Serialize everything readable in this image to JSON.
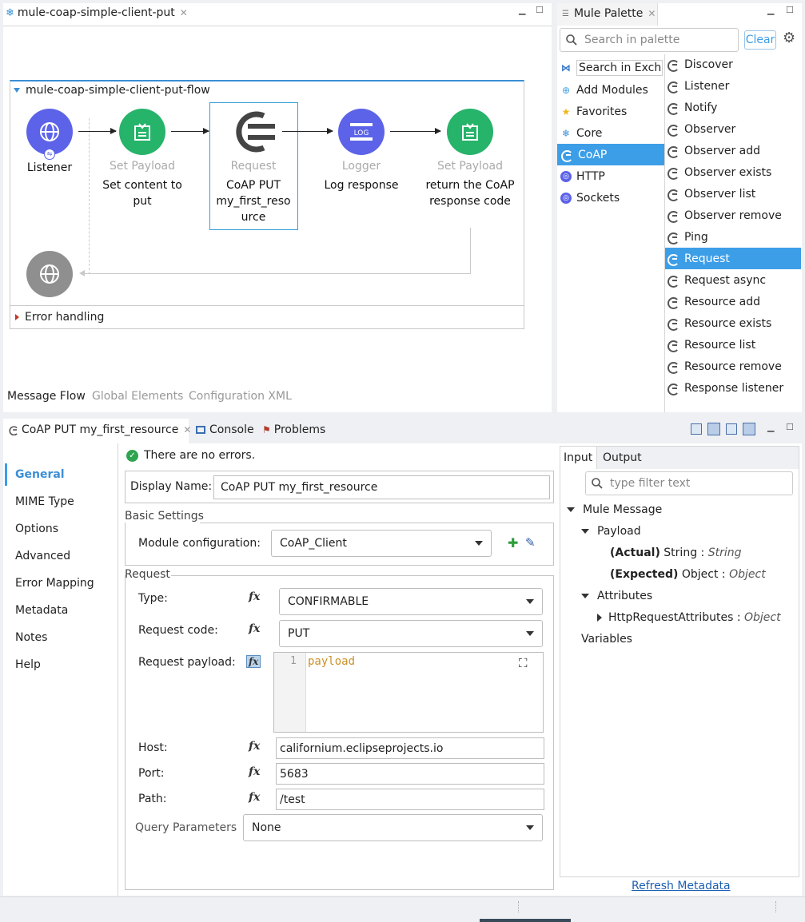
{
  "editor": {
    "tab_title": "mule-coap-simple-client-put",
    "flow_name": "mule-coap-simple-client-put-flow",
    "nodes": [
      {
        "type": "",
        "label": "Listener"
      },
      {
        "type": "Set Payload",
        "label": "Set content to put"
      },
      {
        "type": "Request",
        "label": "CoAP PUT my_first_reso urce"
      },
      {
        "type": "Logger",
        "label": "Log response"
      },
      {
        "type": "Set Payload",
        "label": "return the CoAP response code"
      }
    ],
    "logger_icon_text": "LOG",
    "error_handling": "Error handling",
    "bottom_tabs": [
      "Message Flow",
      "Global Elements",
      "Configuration XML"
    ]
  },
  "palette": {
    "title": "Mule Palette",
    "search_placeholder": "Search in palette",
    "clear_label": "Clear",
    "left_items": [
      {
        "label": "Search in Excha",
        "icon": "exchange-icon"
      },
      {
        "label": "Add Modules",
        "icon": "add-circle-icon"
      },
      {
        "label": "Favorites",
        "icon": "star-icon"
      },
      {
        "label": "Core",
        "icon": "mule-icon"
      },
      {
        "label": "CoAP",
        "icon": "coap-icon"
      },
      {
        "label": "HTTP",
        "icon": "globe-icon"
      },
      {
        "label": "Sockets",
        "icon": "globe-icon"
      }
    ],
    "right_items": [
      "Discover",
      "Listener",
      "Notify",
      "Observer",
      "Observer add",
      "Observer exists",
      "Observer list",
      "Observer remove",
      "Ping",
      "Request",
      "Request async",
      "Resource add",
      "Resource exists",
      "Resource list",
      "Resource remove",
      "Response listener"
    ],
    "selected_left": "CoAP",
    "selected_right": "Request"
  },
  "props": {
    "tab_title": "CoAP PUT my_first_resource",
    "console_tab": "Console",
    "problems_tab": "Problems",
    "side_items": [
      "General",
      "MIME Type",
      "Options",
      "Advanced",
      "Error Mapping",
      "Metadata",
      "Notes",
      "Help"
    ],
    "status": "There are no errors.",
    "display_name_label": "Display Name:",
    "display_name_value": "CoAP PUT my_first_resource",
    "basic_settings": "Basic Settings",
    "module_config_label": "Module configuration:",
    "module_config_value": "CoAP_Client",
    "request_group": "Request",
    "type_label": "Type:",
    "type_value": "CONFIRMABLE",
    "code_label": "Request code:",
    "code_value": "PUT",
    "payload_label": "Request payload:",
    "payload_line_no": "1",
    "payload_code": "payload",
    "host_label": "Host:",
    "host_value": "californium.eclipseprojects.io",
    "port_label": "Port:",
    "port_value": "5683",
    "path_label": "Path:",
    "path_value": "/test",
    "query_label": "Query Parameters",
    "query_value": "None",
    "fx": "fx"
  },
  "metadata": {
    "tabs": [
      "Input",
      "Output"
    ],
    "filter_placeholder": "type filter text",
    "mule_message": "Mule Message",
    "payload": "Payload",
    "actual_label": "(Actual)",
    "actual_type": "String :",
    "actual_value": "String",
    "expected_label": "(Expected)",
    "expected_type": "Object :",
    "expected_value": "Object",
    "attributes": "Attributes",
    "attr_item": "HttpRequestAttributes :",
    "attr_value": "Object",
    "variables": "Variables",
    "refresh": "Refresh Metadata"
  },
  "colors": {
    "source_purple": "#5c63e8",
    "transformer_green": "#26b36a",
    "logger_purple": "#5c63e8",
    "selection_blue": "#3d9ee8",
    "gray_node": "#8f8f8f",
    "link_blue": "#1a5fb4"
  }
}
